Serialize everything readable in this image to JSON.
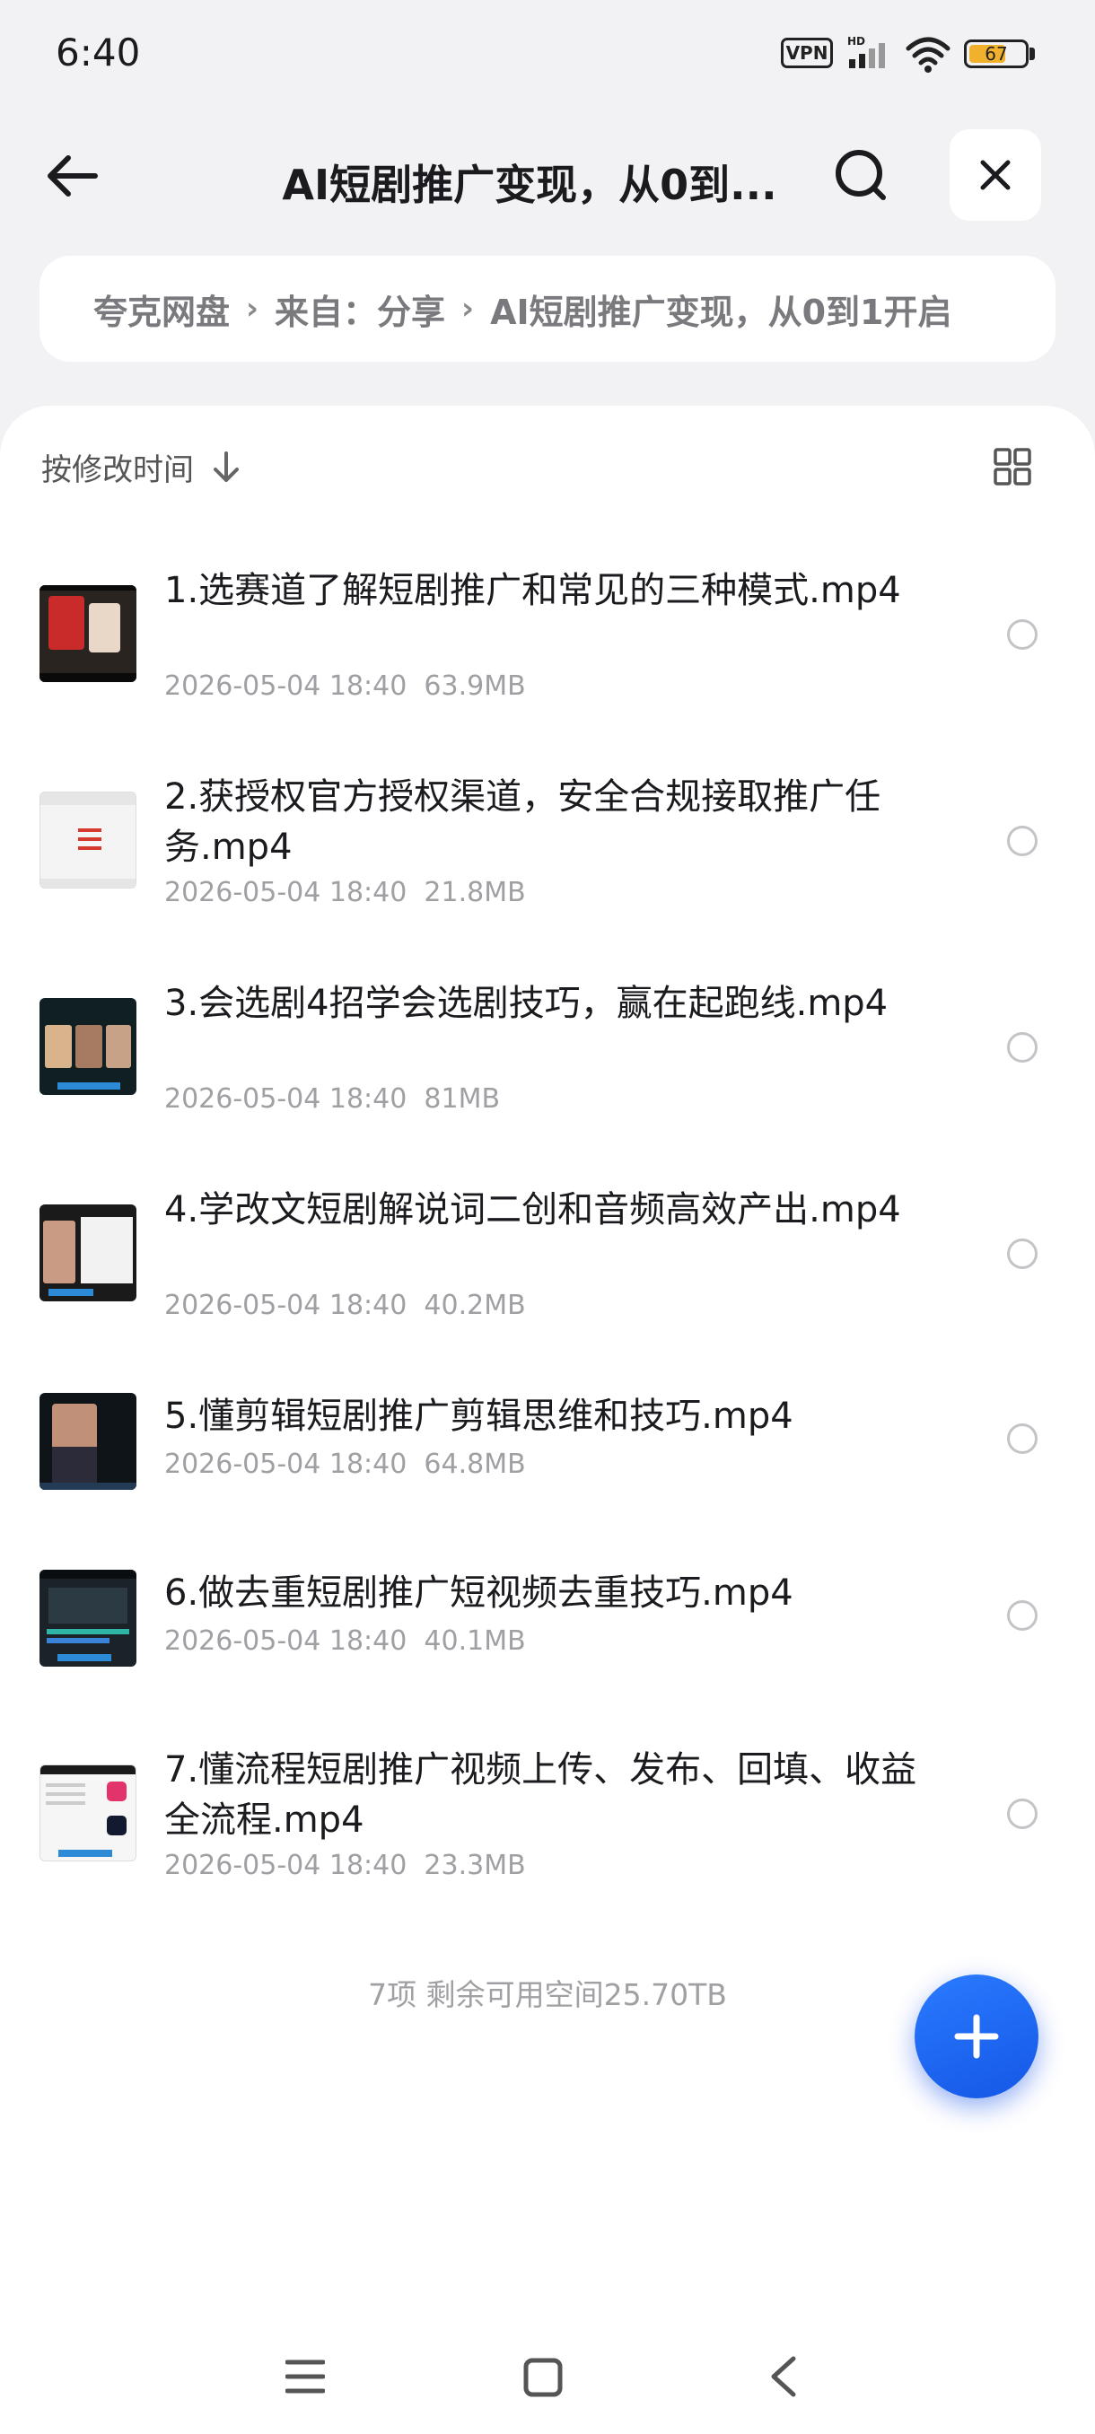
{
  "status_bar": {
    "time": "6:40",
    "vpn_label": "VPN",
    "network_label": "HD",
    "battery_level": "67",
    "battery_fraction": 0.67,
    "battery_color": "#f2b12c"
  },
  "header": {
    "title": "AI短剧推广变现，从0到...",
    "back_icon": "arrow-left-icon",
    "search_icon": "search-icon",
    "close_icon": "close-icon"
  },
  "breadcrumb": {
    "items": [
      "夸克网盘",
      "来自：分享",
      "AI短剧推广变现，从0到1开启"
    ],
    "separator": "›"
  },
  "sort": {
    "label": "按修改时间",
    "direction_icon": "arrow-down-icon",
    "view_toggle_icon": "grid-view-icon"
  },
  "files": [
    {
      "name": "1.选赛道了解短剧推广和常见的三种模式.mp4",
      "date": "2026-05-04 18:40",
      "size": "63.9MB"
    },
    {
      "name": "2.获授权官方授权渠道，安全合规接取推广任务.mp4",
      "date": "2026-05-04 18:40",
      "size": "21.8MB"
    },
    {
      "name": "3.会选剧4招学会选剧技巧，赢在起跑线.mp4",
      "date": "2026-05-04 18:40",
      "size": "81MB"
    },
    {
      "name": "4.学改文短剧解说词二创和音频高效产出.mp4",
      "date": "2026-05-04 18:40",
      "size": "40.2MB"
    },
    {
      "name": "5.懂剪辑短剧推广剪辑思维和技巧.mp4",
      "date": "2026-05-04 18:40",
      "size": "64.8MB"
    },
    {
      "name": "6.做去重短剧推广短视频去重技巧.mp4",
      "date": "2026-05-04 18:40",
      "size": "40.1MB"
    },
    {
      "name": "7.懂流程短剧推广视频上传、发布、回填、收益全流程.mp4",
      "date": "2026-05-04 18:40",
      "size": "23.3MB"
    }
  ],
  "summary": "7项  剩余可用空间25.70TB",
  "fab_icon": "plus-icon",
  "accent_color": "#1f66f0",
  "nav": {
    "menu_icon": "menu-icon",
    "home_icon": "home-icon",
    "back_icon": "back-chevron-icon"
  }
}
